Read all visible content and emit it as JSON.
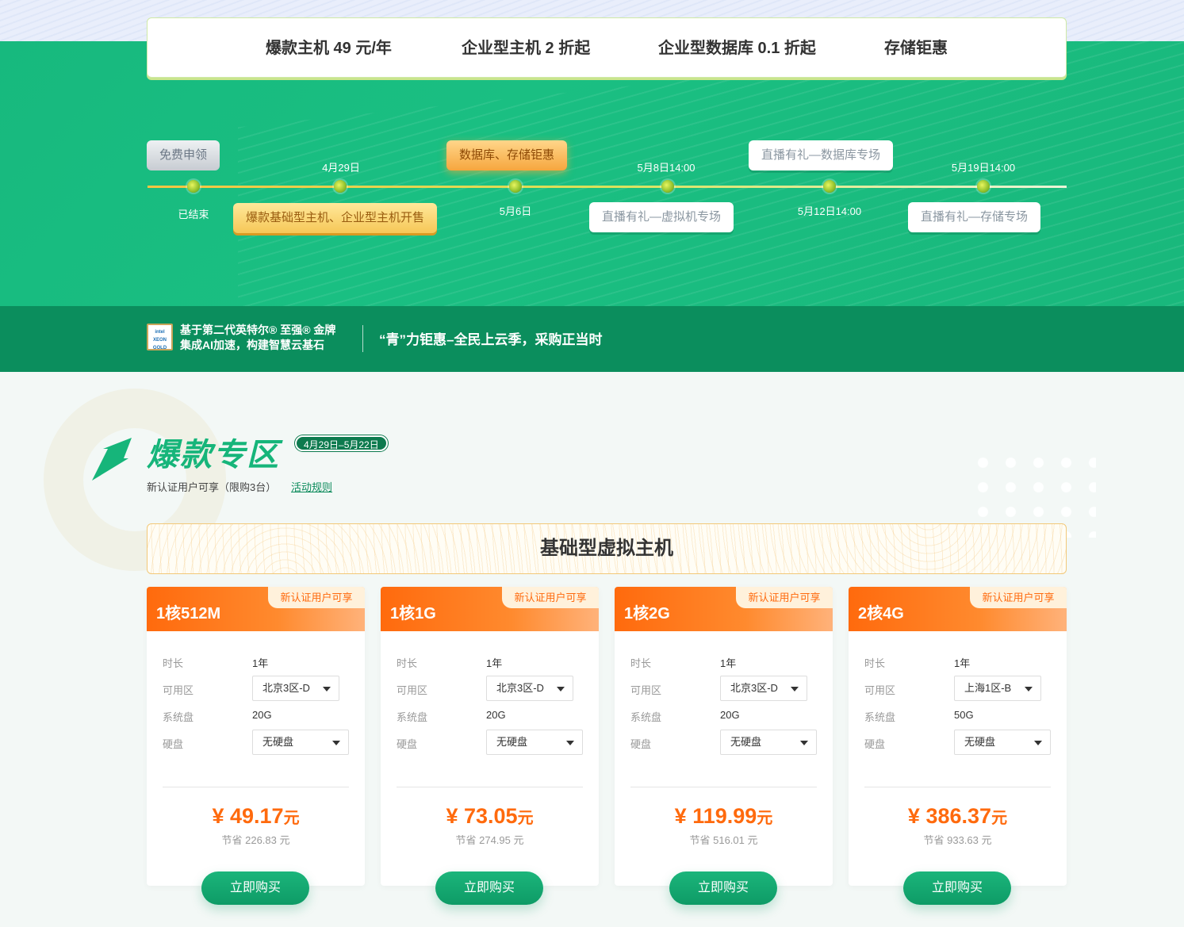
{
  "nav": {
    "items": [
      {
        "label": "爆款主机 49 元/年"
      },
      {
        "label": "企业型主机 2 折起"
      },
      {
        "label": "企业型数据库 0.1 折起"
      },
      {
        "label": "存储钜惠"
      }
    ]
  },
  "timeline": {
    "free_tag": "免费申领",
    "ended": "已结束",
    "date_0429": "4月29日",
    "tag_hot_sale": "爆款基础型主机、企业型主机开售",
    "tag_db_storage": "数据库、存储钜惠",
    "date_0506": "5月6日",
    "date_0508": "5月8日14:00",
    "tag_live_vm": "直播有礼—虚拟机专场",
    "tag_live_db": "直播有礼—数据库专场",
    "date_0512": "5月12日14:00",
    "date_0519": "5月19日14:00",
    "tag_live_storage": "直播有礼—存储专场"
  },
  "strip": {
    "intel_logo_text": "intel XEON GOLD",
    "intel_line1": "基于第二代英特尔® 至强® 金牌",
    "intel_line2": "集成AI加速，构建智慧云基石",
    "slogan": "“青”力钜惠–全民上云季，采购正当时"
  },
  "section": {
    "title": "爆款专区",
    "date_badge": "4月29日–5月22日",
    "subtitle": "新认证用户可享（限购3台）",
    "rules_link": "活动规则",
    "category": "基础型虚拟主机"
  },
  "labels": {
    "duration": "时长",
    "zone": "可用区",
    "sys_disk": "系统盘",
    "disk": "硬盘",
    "badge": "新认证用户可享",
    "currency": "¥",
    "unit": "元",
    "buy": "立即购买"
  },
  "cards": [
    {
      "title": "1核512M",
      "duration": "1年",
      "zone": "北京3区-D",
      "sys_disk": "20G",
      "disk": "无硬盘",
      "price": "49.17",
      "save": "节省 226.83 元"
    },
    {
      "title": "1核1G",
      "duration": "1年",
      "zone": "北京3区-D",
      "sys_disk": "20G",
      "disk": "无硬盘",
      "price": "73.05",
      "save": "节省 274.95 元"
    },
    {
      "title": "1核2G",
      "duration": "1年",
      "zone": "北京3区-D",
      "sys_disk": "20G",
      "disk": "无硬盘",
      "price": "119.99",
      "save": "节省 516.01 元"
    },
    {
      "title": "2核4G",
      "duration": "1年",
      "zone": "上海1区-B",
      "sys_disk": "50G",
      "disk": "无硬盘",
      "price": "386.37",
      "save": "节省 933.63 元"
    }
  ]
}
